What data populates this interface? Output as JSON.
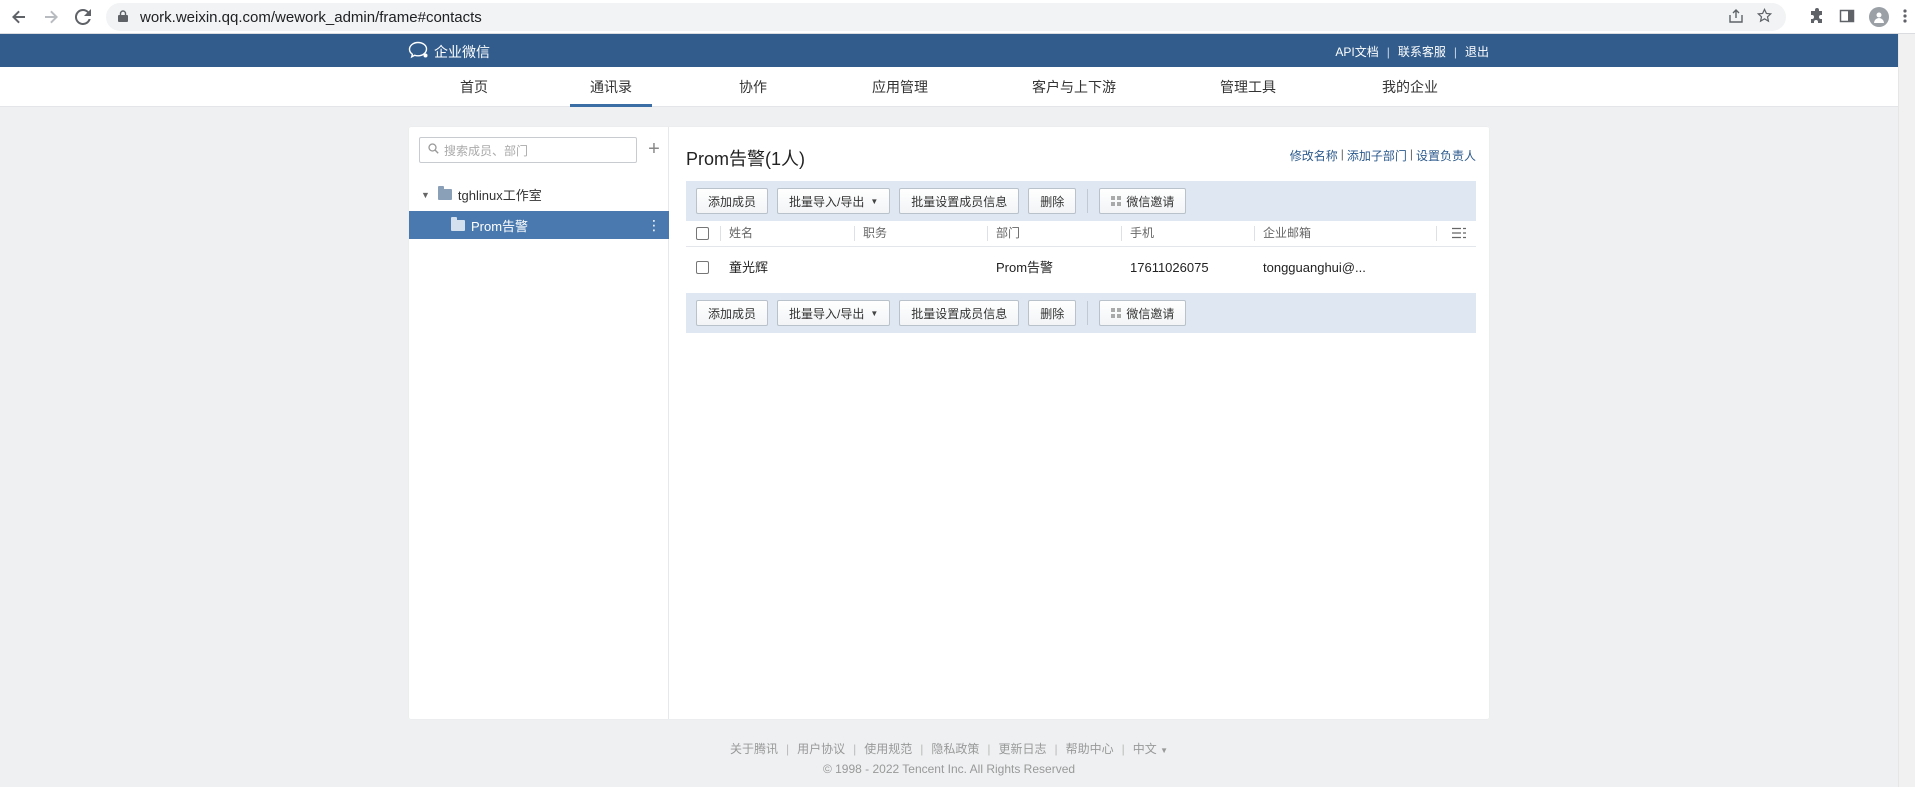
{
  "browser": {
    "url": "work.weixin.qq.com/wework_admin/frame#contacts"
  },
  "header": {
    "logo_text": "企业微信",
    "links": [
      "API文档",
      "联系客服",
      "退出"
    ]
  },
  "nav": {
    "items": [
      "首页",
      "通讯录",
      "协作",
      "应用管理",
      "客户与上下游",
      "管理工具",
      "我的企业"
    ],
    "active_index": 1
  },
  "sidebar": {
    "search_placeholder": "搜索成员、部门",
    "root": "tghlinux工作室",
    "child": "Prom告警"
  },
  "department": {
    "title": "Prom告警(1人)",
    "actions": [
      "修改名称",
      "添加子部门",
      "设置负责人"
    ]
  },
  "toolbar": {
    "add_member": "添加成员",
    "batch_import_export": "批量导入/导出",
    "batch_set_info": "批量设置成员信息",
    "delete": "删除",
    "wechat_invite": "微信邀请"
  },
  "table": {
    "columns": [
      "姓名",
      "职务",
      "部门",
      "手机",
      "企业邮箱"
    ],
    "rows": [
      {
        "name": "童光辉",
        "title": "",
        "dept": "Prom告警",
        "phone": "17611026075",
        "email": "tongguanghui@..."
      }
    ]
  },
  "footer": {
    "links": [
      "关于腾讯",
      "用户协议",
      "使用规范",
      "隐私政策",
      "更新日志",
      "帮助中心",
      "中文"
    ],
    "copyright": "© 1998 - 2022 Tencent Inc. All Rights Reserved"
  },
  "colors": {
    "header_bg": "#315c8c",
    "selected_bg": "#4a79b0",
    "toolbar_bg": "#dee7f2",
    "link": "#2c5a8c"
  }
}
